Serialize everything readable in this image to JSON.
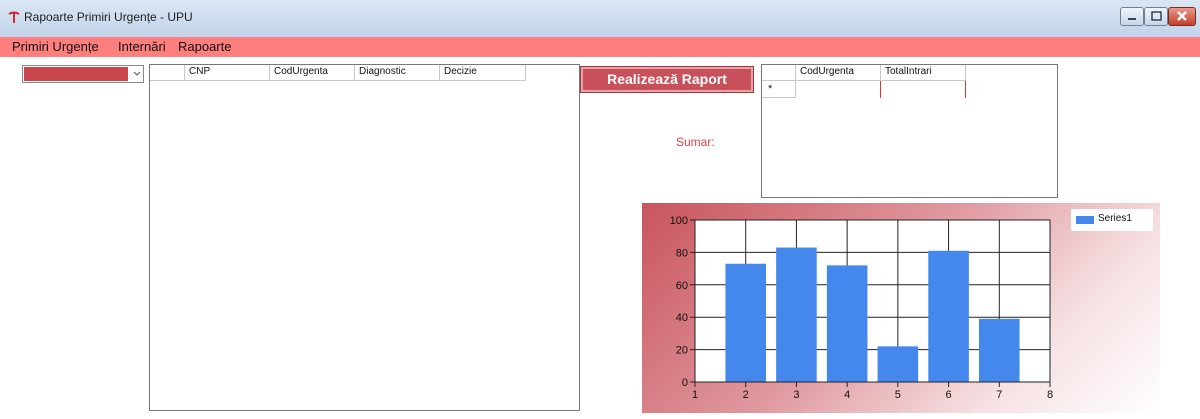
{
  "window": {
    "title": "Rapoarte Primiri Urgențe - UPU"
  },
  "menu": {
    "items": [
      "Primiri Urgențe",
      "Internări",
      "Rapoarte"
    ]
  },
  "grid_main": {
    "columns": [
      "CNP",
      "CodUrgenta",
      "Diagnostic",
      "Decizie"
    ]
  },
  "raport_button": {
    "label": "Realizează Raport"
  },
  "summary": {
    "label": "Sumar:"
  },
  "grid_summary": {
    "columns": [
      "CodUrgenta",
      "TotalIntrari"
    ],
    "new_row_marker": "*"
  },
  "colors": {
    "menu_bar": "#ff7f7f",
    "accent": "#c8505a",
    "series_fill": "#4488ee"
  },
  "chart_data": {
    "type": "bar",
    "x": [
      2,
      3,
      4,
      5,
      6,
      7
    ],
    "series": [
      {
        "name": "Series1",
        "values": [
          73,
          83,
          72,
          22,
          81,
          39
        ]
      }
    ],
    "xlim": [
      1,
      8
    ],
    "ylim": [
      0,
      100
    ],
    "x_ticks": [
      1,
      2,
      3,
      4,
      5,
      6,
      7,
      8
    ],
    "y_ticks": [
      0,
      20,
      40,
      60,
      80,
      100
    ],
    "grid": true,
    "legend": "top-right"
  }
}
